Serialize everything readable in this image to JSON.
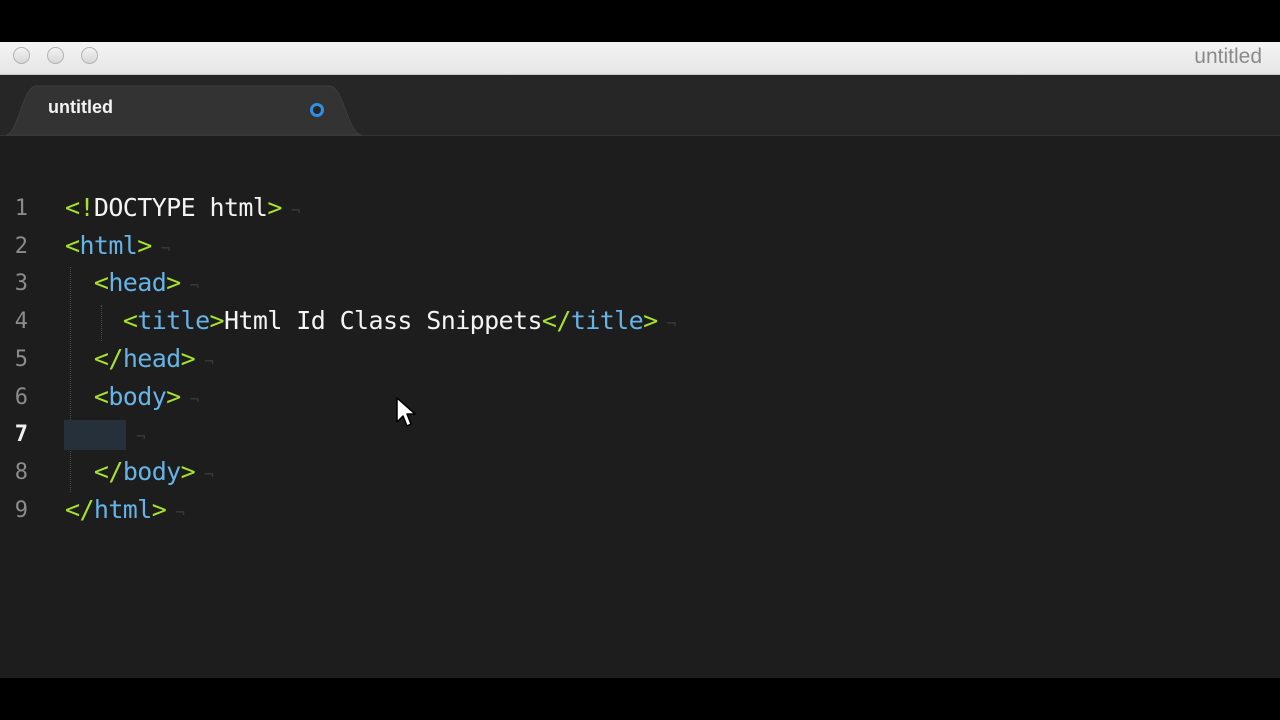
{
  "window": {
    "title": "untitled"
  },
  "tab": {
    "label": "untitled",
    "modified": true
  },
  "editor": {
    "active_line": 7,
    "lines": [
      {
        "number": "1",
        "tokens": [
          {
            "t": "<!",
            "c": "p"
          },
          {
            "t": "DOCTYPE html",
            "c": "dt"
          },
          {
            "t": ">",
            "c": "p"
          }
        ]
      },
      {
        "number": "2",
        "tokens": [
          {
            "t": "<",
            "c": "p"
          },
          {
            "t": "html",
            "c": "tg"
          },
          {
            "t": ">",
            "c": "p"
          }
        ]
      },
      {
        "number": "3",
        "tokens": [
          {
            "t": "  "
          },
          {
            "t": "<",
            "c": "p"
          },
          {
            "t": "head",
            "c": "tg"
          },
          {
            "t": ">",
            "c": "p"
          }
        ]
      },
      {
        "number": "4",
        "tokens": [
          {
            "t": "    "
          },
          {
            "t": "<",
            "c": "p"
          },
          {
            "t": "title",
            "c": "tg"
          },
          {
            "t": ">",
            "c": "p"
          },
          {
            "t": "Html Id Class Snippets",
            "c": "tx"
          },
          {
            "t": "</",
            "c": "p"
          },
          {
            "t": "title",
            "c": "tg"
          },
          {
            "t": ">",
            "c": "p"
          }
        ]
      },
      {
        "number": "5",
        "tokens": [
          {
            "t": "  "
          },
          {
            "t": "</",
            "c": "p"
          },
          {
            "t": "head",
            "c": "tg"
          },
          {
            "t": ">",
            "c": "p"
          }
        ]
      },
      {
        "number": "6",
        "tokens": [
          {
            "t": "  "
          },
          {
            "t": "<",
            "c": "p"
          },
          {
            "t": "body",
            "c": "tg"
          },
          {
            "t": ">",
            "c": "p"
          }
        ]
      },
      {
        "number": "7",
        "tokens": []
      },
      {
        "number": "8",
        "tokens": [
          {
            "t": "  "
          },
          {
            "t": "</",
            "c": "p"
          },
          {
            "t": "body",
            "c": "tg"
          },
          {
            "t": ">",
            "c": "p"
          }
        ]
      },
      {
        "number": "9",
        "tokens": [
          {
            "t": "</",
            "c": "p"
          },
          {
            "t": "html",
            "c": "tg"
          },
          {
            "t": ">",
            "c": "p"
          }
        ]
      }
    ]
  },
  "colors": {
    "punctuation": "#a6e22e",
    "tag": "#66b3e6",
    "text": "#f4f4f4",
    "background": "#1d1d1d",
    "modified_dot": "#2f8fe0"
  }
}
